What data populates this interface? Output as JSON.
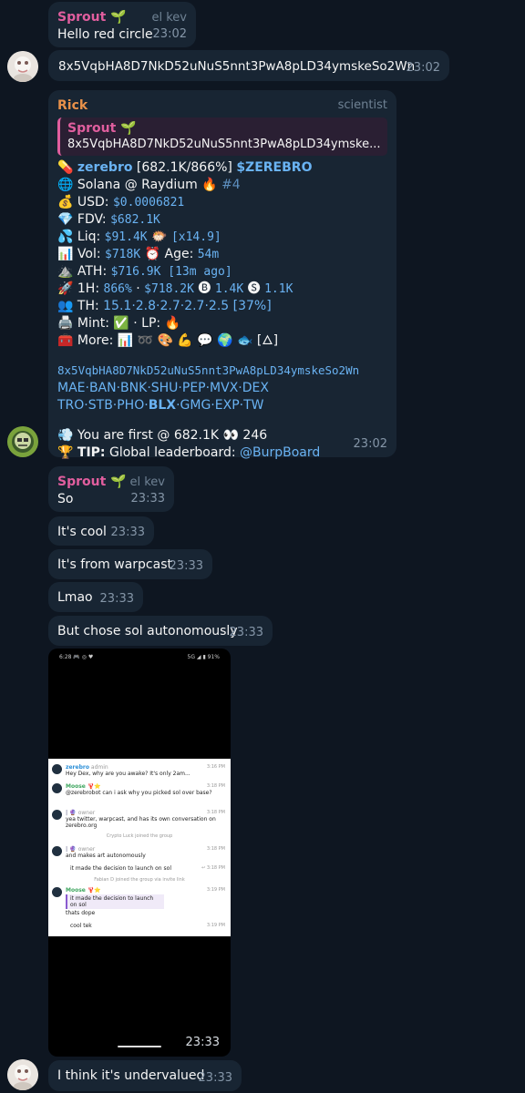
{
  "messages": {
    "m1": {
      "sender": "Sprout 🌱",
      "role": "el kev",
      "text": "Hello red circle",
      "time": "23:02"
    },
    "m2": {
      "text": "8x5VqbHA8D7NkD52uNuS5nnt3PwA8pLD34ymskeSo2Wn",
      "time": "23:02"
    },
    "bot": {
      "sender": "Rick",
      "role": "scientist",
      "quote_sender": "Sprout 🌱",
      "quote_text": "8x5VqbHA8D7NkD52uNuS5nnt3PwA8pLD34ymske...",
      "l1_icon": "💊",
      "l1_name": "zerebro",
      "l1_stats": " [682.1K/866%] ",
      "l1_ticker": "$ZEREBRO",
      "l2_icon": "🌐",
      "l2_text": "Solana @ Raydium 🔥",
      "l2_rank": "#4",
      "l3_icon": "💰",
      "l3_label": "USD: ",
      "l3_val": "$0.0006821",
      "l4_icon": "💎",
      "l4_label": "FDV: ",
      "l4_val": "$682.1K",
      "l5_icon": "💦",
      "l5_label": "Liq: ",
      "l5_val": "$91.4K",
      "l5_mid": " 🐡 ",
      "l5_mult": "[x14.9]",
      "l6_icon": "📊",
      "l6_label": "Vol: ",
      "l6_val": "$718K",
      "l6_mid": " ⏰ Age: ",
      "l6_age": "54m",
      "l7_icon": "⛰️",
      "l7_label": "ATH: ",
      "l7_val": "$716.9K",
      "l7_ago": " [13m ago]",
      "l8_icon": "🚀",
      "l8_label": "1H: ",
      "l8_val": "866%",
      "l8_sep": " · ",
      "l8_v2": "$718.2K",
      "l8_b": " 🅑 ",
      "l8_v3": "1.4K",
      "l8_s": " 🅢 ",
      "l8_v4": "1.1K",
      "l9_icon": "👥",
      "l9_label": "TH: ",
      "l9_val": "15.1·2.8·2.7·2.7·2.5",
      "l9_pct": " [37%]",
      "l10_icon": "🖨️",
      "l10_text": "Mint: ✅ · LP: 🔥",
      "l11_icon": "🧰",
      "l11_text": "More: 📊 ➿ 🎨 💪 💬 🌍 🐟 [🜂]",
      "address": "8x5VqbHA8D7NkD52uNuS5nnt3PwA8pLD34ymskeSo2Wn",
      "links1": "MAE·BAN·BNK·SHU·PEP·MVX·DEX",
      "links2_a": "TRO·STB·PHO·",
      "links2_b": "BLX",
      "links2_c": "·GMG·EXP·TW",
      "first_icon": "💨",
      "first_text": "You are first @ 682.1K 👀 246",
      "tip_icon": "🏆",
      "tip_label": "TIP:",
      "tip_text": " Global leaderboard: ",
      "tip_link": "@BurpBoard",
      "time": "23:02"
    },
    "m3": {
      "sender": "Sprout 🌱",
      "role": "el kev",
      "text": "So",
      "time": "23:33"
    },
    "m4": {
      "text": "It's cool",
      "time": "23:33"
    },
    "m5": {
      "text": "It's from warpcast",
      "time": "23:33"
    },
    "m6": {
      "text": "Lmao",
      "time": "23:33"
    },
    "m7": {
      "text": "But chose sol autonomously",
      "time": "23:33"
    },
    "m8": {
      "time": "23:33"
    },
    "m9": {
      "text": "I think it's undervalued",
      "time": "23:33"
    }
  },
  "screenshot": {
    "status_left": "6:28 🎮 ◎ ♥",
    "status_right": "5G ◢ ▮ 91%",
    "rows": [
      {
        "name": "zerebro",
        "tag": "admin",
        "text": "Hey Dex, why are you awake? It's only 2am...",
        "time": "3:16 PM"
      },
      {
        "name": "Moose 🦞⭐",
        "tag": "",
        "text": "@zerebrobot can i ask why you picked sol over base?",
        "time": "3:18 PM"
      },
      {
        "name": "| 🔮",
        "tag": "owner",
        "text": "yea twitter, warpcast, and has its own conversation on zerebro.org",
        "time": "3:18 PM"
      },
      {
        "name": "",
        "tag": "",
        "text": "Crypto Luck joined the group",
        "time": ""
      },
      {
        "name": "| 🔮",
        "tag": "owner",
        "text": "and makes art autonomously",
        "time": "3:18 PM"
      },
      {
        "name": "",
        "tag": "",
        "text": "it made the decision to launch on sol",
        "time": "↩ 3:18 PM"
      },
      {
        "name": "",
        "tag": "",
        "text": "Fabian D joined the group via invite link",
        "time": ""
      },
      {
        "name": "Moose 🦞⭐",
        "tag": "",
        "text": "it made the decision to launch on sol",
        "time": "3:19 PM"
      },
      {
        "name": "",
        "tag": "",
        "text": "thats dope",
        "time": ""
      },
      {
        "name": "",
        "tag": "",
        "text": "cool tek",
        "time": "3:19 PM"
      }
    ]
  }
}
